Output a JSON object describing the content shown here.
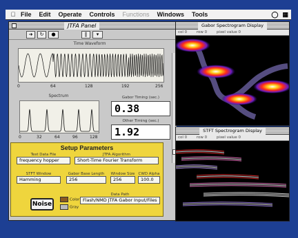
{
  "menubar": {
    "items": [
      "File",
      "Edit",
      "Operate",
      "Controls",
      "Functions",
      "Windows",
      "Tools"
    ]
  },
  "panel": {
    "title": "JTFA Panel",
    "waveform_label": "Time Waveform",
    "waveform_ticks": [
      "0",
      "64",
      "128",
      "192",
      "256"
    ],
    "spectrum_label": "Spectrum",
    "spectrum_ticks": [
      "0",
      "32",
      "64",
      "96",
      "128"
    ],
    "gabor_timing_label": "Gabor Timing (sec.)",
    "gabor_timing_value": "0.38",
    "other_timing_label": "Other Timing (sec.)",
    "other_timing_value": "1.92"
  },
  "setup": {
    "title": "Setup Parameters",
    "test_data_file_label": "Test Data File",
    "test_data_file_value": "frequency hopper",
    "jtfa_algorithm_label": "JTFA Algorithm",
    "jtfa_algorithm_value": "Short-Time Fourier Transform",
    "stft_window_label": "STFT Window",
    "stft_window_value": "Hamming",
    "gabor_base_length_label": "Gabor Base Length",
    "gabor_base_length_value": "256",
    "window_size_label": "Window Size",
    "window_size_value": "256",
    "cwd_alpha_label": "CWD Alpha",
    "cwd_alpha_value": "100.0",
    "noise_button": "Noise",
    "color_label": "Color",
    "gray_label": "Gray",
    "data_path_label": "Data Path",
    "data_path_value": "Flash/NMD JTFA Gabor Input/Files"
  },
  "gabor_window": {
    "title": "Gabor Spectrogram Display",
    "status": [
      "col 0",
      "row 0",
      "pixel value 0"
    ]
  },
  "stft_window": {
    "title": "STFT Spectrogram Display",
    "status": [
      "col 0",
      "row 0",
      "pixel value 0"
    ]
  },
  "colors": {
    "desktop": "#1d3f93",
    "setup_panel": "#efd53d",
    "spectrogram_bg": "#000000"
  }
}
